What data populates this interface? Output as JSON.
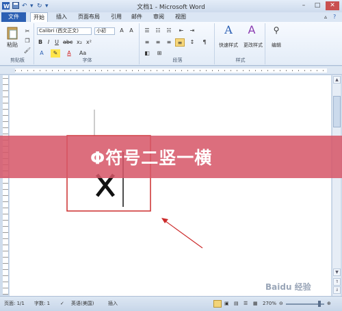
{
  "window": {
    "title": "文档1 - Microsoft Word"
  },
  "tabs": [
    "文件",
    "开始",
    "插入",
    "页面布局",
    "引用",
    "邮件",
    "审阅",
    "视图"
  ],
  "ribbon": {
    "clipboard": {
      "paste_label": "粘贴",
      "group_label": "剪贴板"
    },
    "font": {
      "font_name": "Calibri (西文正文)",
      "font_size": "小初",
      "group_label": "字体"
    },
    "paragraph": {
      "group_label": "段落"
    },
    "styles": {
      "quick_styles": "快速样式",
      "change_styles": "更改样式",
      "group_label": "样式"
    },
    "editing": {
      "label": "编辑"
    }
  },
  "banner": {
    "text": "Φ符号二竖一横"
  },
  "status": {
    "page": "页面: 1/1",
    "words": "字数: 1",
    "language": "英语(美国)",
    "mode": "插入",
    "zoom": "270%",
    "zoom_level": 0.87
  },
  "watermark": "Baidu 经验",
  "colors": {
    "accent": "#2b5fb3",
    "banner": "#d65668",
    "annotation_red": "#cc2b2b"
  }
}
